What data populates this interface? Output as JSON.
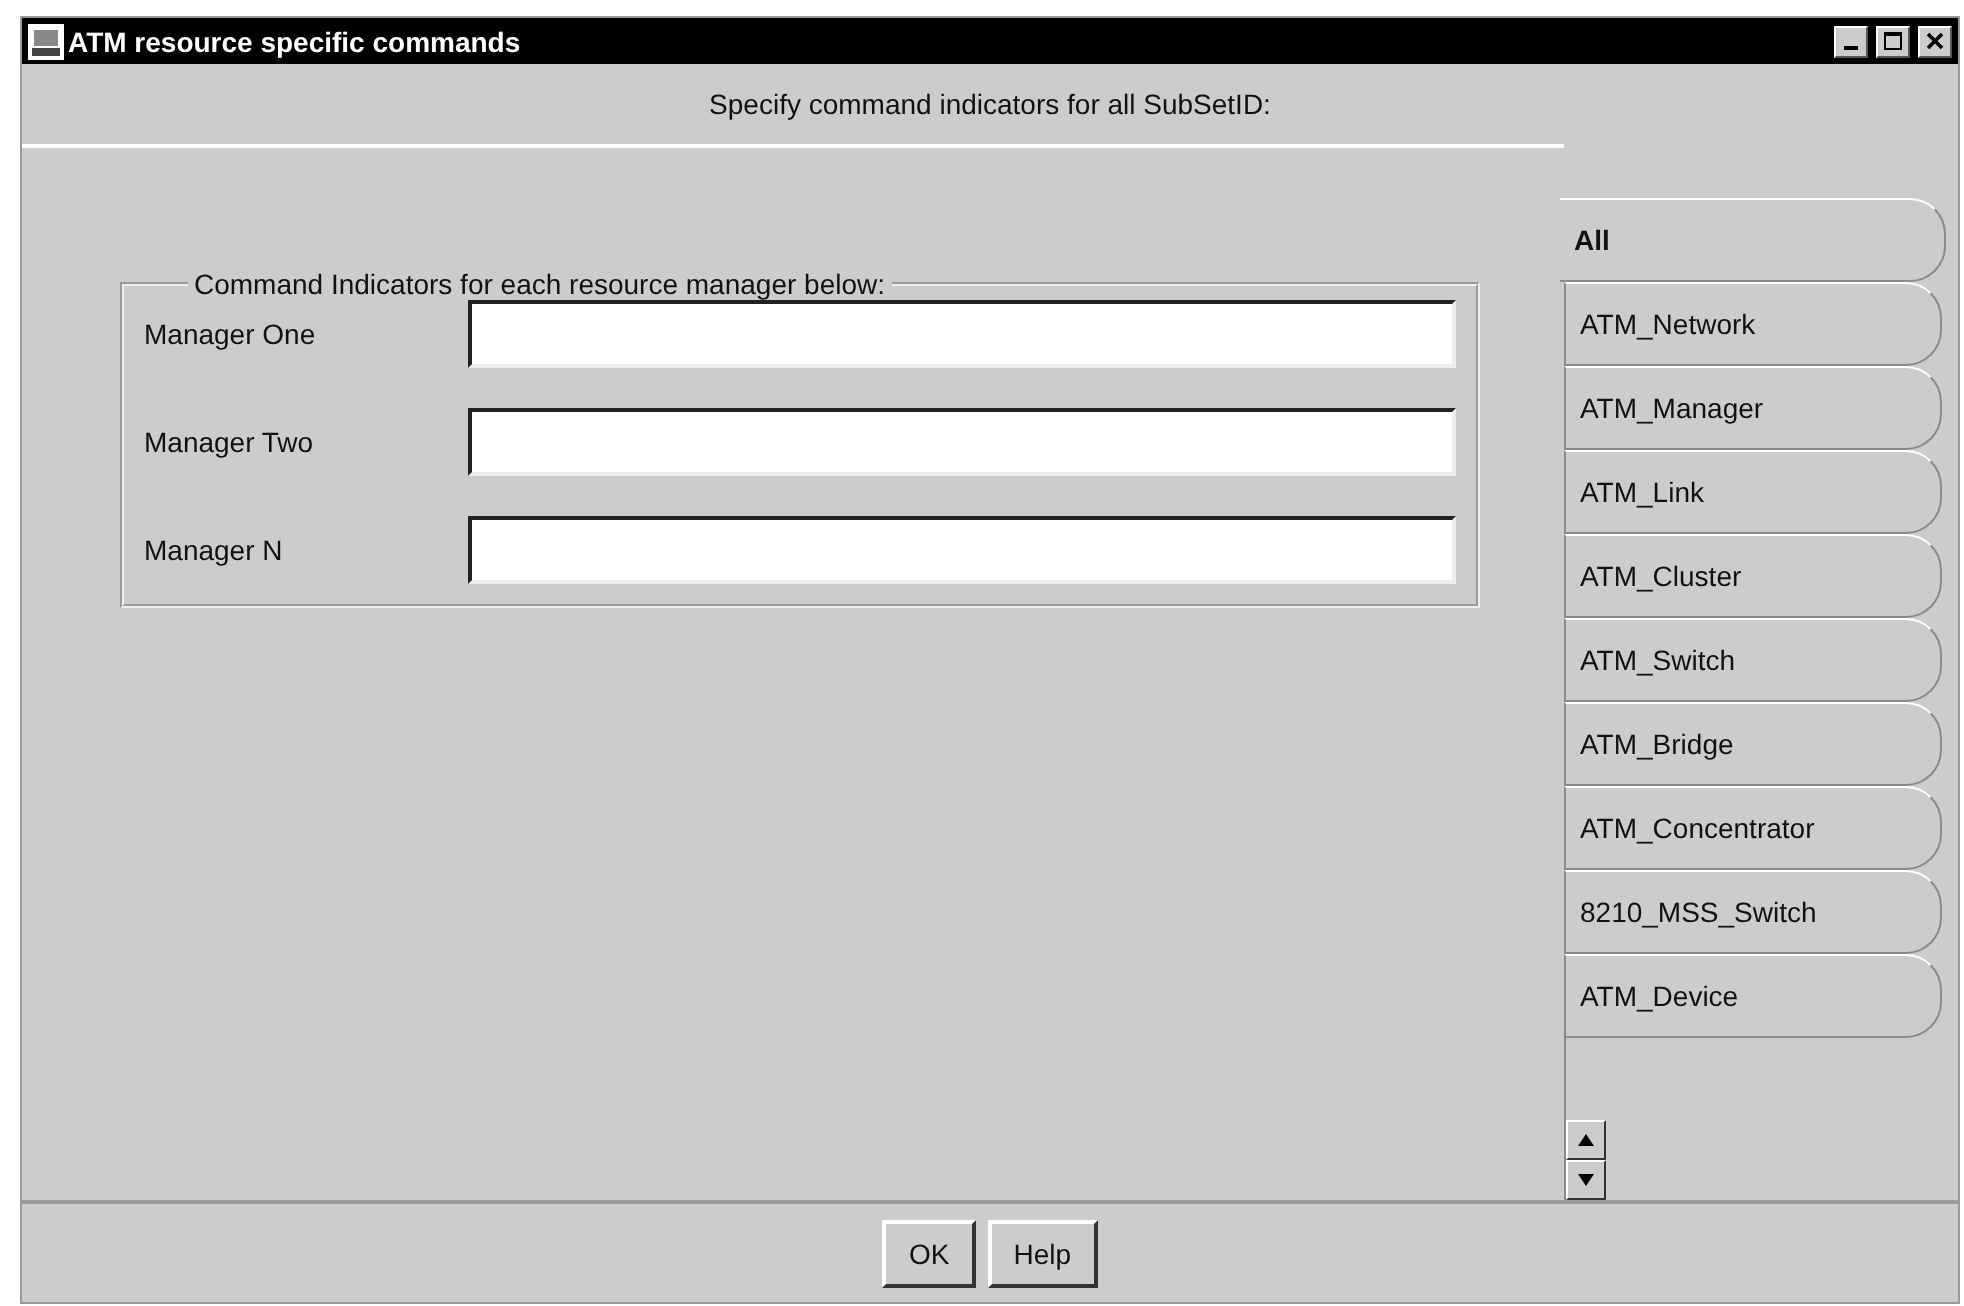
{
  "window": {
    "title": "ATM resource specific commands"
  },
  "prompt": "Specify command indicators for all SubSetID:",
  "group": {
    "title": "Command Indicators for each resource manager below:",
    "fields": [
      {
        "label": "Manager One"
      },
      {
        "label": "Manager Two"
      },
      {
        "label": "Manager N"
      }
    ]
  },
  "tabs": [
    {
      "label": "All",
      "selected": true
    },
    {
      "label": "ATM_Network",
      "selected": false
    },
    {
      "label": "ATM_Manager",
      "selected": false
    },
    {
      "label": "ATM_Link",
      "selected": false
    },
    {
      "label": "ATM_Cluster",
      "selected": false
    },
    {
      "label": "ATM_Switch",
      "selected": false
    },
    {
      "label": "ATM_Bridge",
      "selected": false
    },
    {
      "label": "ATM_Concentrator",
      "selected": false
    },
    {
      "label": "8210_MSS_Switch",
      "selected": false
    },
    {
      "label": "ATM_Device",
      "selected": false
    }
  ],
  "buttons": [
    "OK",
    "Help"
  ]
}
